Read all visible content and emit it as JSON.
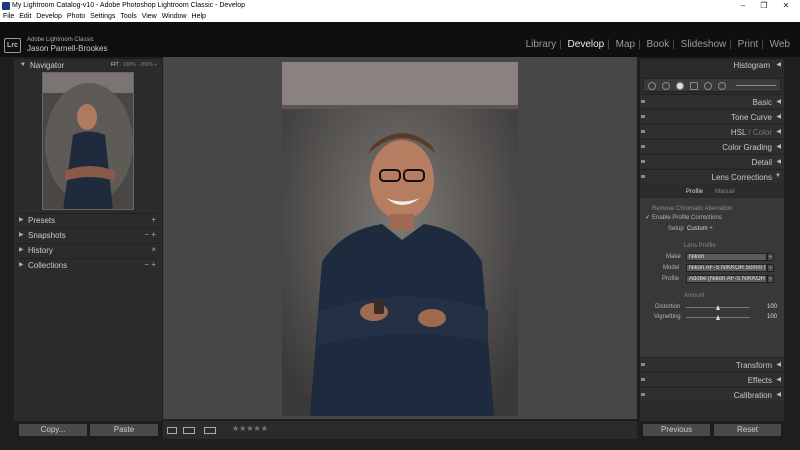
{
  "window": {
    "title": "My Lightroom Catalog-v10 - Adobe Photoshop Lightroom Classic - Develop"
  },
  "menu": [
    "File",
    "Edit",
    "Develop",
    "Photo",
    "Settings",
    "Tools",
    "View",
    "Window",
    "Help"
  ],
  "identity": {
    "logo": "Lrc",
    "app": "Adobe Lightroom Classic",
    "user": "Jason Parnell-Brookes"
  },
  "modules": {
    "items": [
      "Library",
      "Develop",
      "Map",
      "Book",
      "Slideshow",
      "Print",
      "Web"
    ],
    "active": "Develop"
  },
  "navigator": {
    "title": "Navigator",
    "zoom": [
      "FIT",
      "100%",
      "200%"
    ]
  },
  "left_panels": [
    {
      "label": "Presets",
      "ctrl": "+"
    },
    {
      "label": "Snapshots",
      "ctrl": "− +"
    },
    {
      "label": "History",
      "ctrl": "×"
    },
    {
      "label": "Collections",
      "ctrl": "− +"
    }
  ],
  "left_buttons": {
    "copy": "Copy...",
    "paste": "Paste"
  },
  "right_panels": {
    "histogram": "Histogram",
    "sections": [
      "Basic",
      "Tone Curve",
      "Color Grading",
      "Detail"
    ],
    "hsl": "HSL",
    "hsl_sep": "/",
    "color": "Color",
    "lens": "Lens Corrections",
    "bottom_sections": [
      "Transform",
      "Effects",
      "Calibration"
    ]
  },
  "lens": {
    "tabs": [
      "Profile",
      "Manual"
    ],
    "active_tab": "Profile",
    "remove_ca": "Remove Chromatic Aberration",
    "enable_profile": "Enable Profile Corrections",
    "enable_checked": true,
    "setup_label": "Setup",
    "setup_value": "Custom ÷",
    "lens_profile": "Lens Profile",
    "make_label": "Make",
    "make_value": "Nikon",
    "model_label": "Model",
    "model_value": "Nikon AF-S NIKKOR 50mm f/1.",
    "profile_label": "Profile",
    "profile_value": "Adobe (Nikon AF-S NIKKOR 5...",
    "amount": "Amount",
    "distortion_label": "Distortion",
    "distortion_value": 100,
    "vignetting_label": "Vignetting",
    "vignetting_value": 100
  },
  "right_buttons": {
    "previous": "Previous",
    "reset": "Reset"
  },
  "toolbar": {
    "stars": "★★★★★"
  }
}
